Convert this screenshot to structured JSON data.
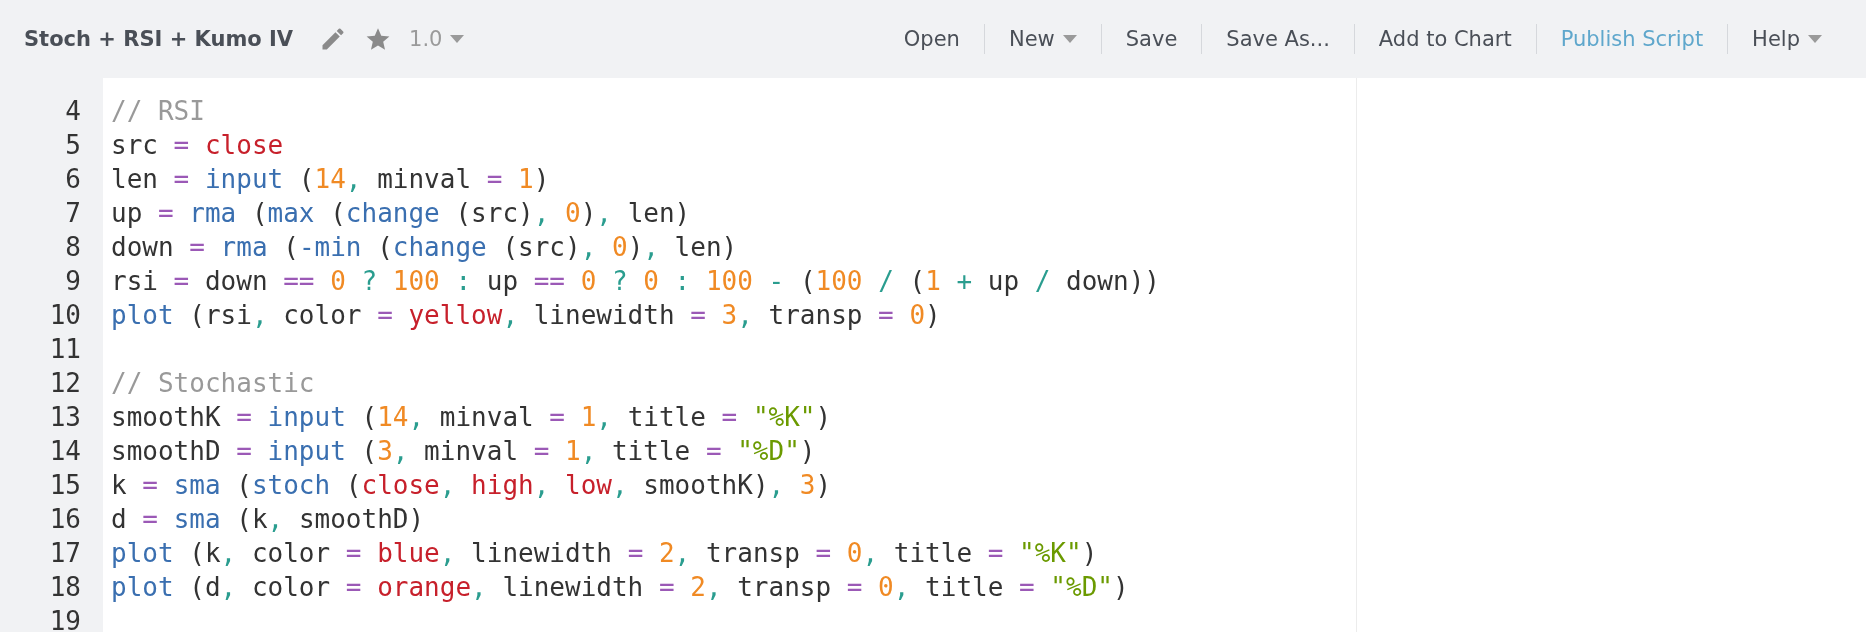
{
  "header": {
    "title": "Stoch + RSI + Kumo IV",
    "version": "1.0",
    "menu": [
      {
        "label": "Open",
        "kind": "plain"
      },
      {
        "label": "New",
        "kind": "dropdown"
      },
      {
        "label": "Save",
        "kind": "plain"
      },
      {
        "label": "Save As...",
        "kind": "plain"
      },
      {
        "label": "Add to Chart",
        "kind": "plain"
      },
      {
        "label": "Publish Script",
        "kind": "link"
      },
      {
        "label": "Help",
        "kind": "dropdown"
      }
    ]
  },
  "editor": {
    "lines": [
      {
        "number": "4",
        "tokens": [
          {
            "kind": "c",
            "text": "// RSI"
          }
        ]
      },
      {
        "number": "5",
        "tokens": [
          {
            "kind": "t",
            "text": "src"
          },
          {
            "kind": "o",
            "text": " = "
          },
          {
            "kind": "v",
            "text": "close"
          }
        ]
      },
      {
        "number": "6",
        "tokens": [
          {
            "kind": "t",
            "text": "len"
          },
          {
            "kind": "o",
            "text": " = "
          },
          {
            "kind": "f",
            "text": "input"
          },
          {
            "kind": "t",
            "text": " ("
          },
          {
            "kind": "n",
            "text": "14"
          },
          {
            "kind": "p",
            "text": ", "
          },
          {
            "kind": "t",
            "text": "minval"
          },
          {
            "kind": "o",
            "text": " = "
          },
          {
            "kind": "n",
            "text": "1"
          },
          {
            "kind": "t",
            "text": ")"
          }
        ]
      },
      {
        "number": "7",
        "tokens": [
          {
            "kind": "t",
            "text": "up"
          },
          {
            "kind": "o",
            "text": " = "
          },
          {
            "kind": "f",
            "text": "rma"
          },
          {
            "kind": "t",
            "text": " ("
          },
          {
            "kind": "f",
            "text": "max"
          },
          {
            "kind": "t",
            "text": " ("
          },
          {
            "kind": "f",
            "text": "change"
          },
          {
            "kind": "t",
            "text": " (src)"
          },
          {
            "kind": "p",
            "text": ", "
          },
          {
            "kind": "n",
            "text": "0"
          },
          {
            "kind": "t",
            "text": ")"
          },
          {
            "kind": "p",
            "text": ", "
          },
          {
            "kind": "t",
            "text": "len)"
          }
        ]
      },
      {
        "number": "8",
        "tokens": [
          {
            "kind": "t",
            "text": "down"
          },
          {
            "kind": "o",
            "text": " = "
          },
          {
            "kind": "f",
            "text": "rma"
          },
          {
            "kind": "t",
            "text": " ("
          },
          {
            "kind": "f",
            "text": "-min"
          },
          {
            "kind": "t",
            "text": " ("
          },
          {
            "kind": "f",
            "text": "change"
          },
          {
            "kind": "t",
            "text": " (src)"
          },
          {
            "kind": "p",
            "text": ", "
          },
          {
            "kind": "n",
            "text": "0"
          },
          {
            "kind": "t",
            "text": ")"
          },
          {
            "kind": "p",
            "text": ", "
          },
          {
            "kind": "t",
            "text": "len)"
          }
        ]
      },
      {
        "number": "9",
        "tokens": [
          {
            "kind": "t",
            "text": "rsi"
          },
          {
            "kind": "o",
            "text": " = "
          },
          {
            "kind": "t",
            "text": "down"
          },
          {
            "kind": "o",
            "text": " == "
          },
          {
            "kind": "n",
            "text": "0"
          },
          {
            "kind": "p",
            "text": " ? "
          },
          {
            "kind": "n",
            "text": "100"
          },
          {
            "kind": "p",
            "text": " : "
          },
          {
            "kind": "t",
            "text": "up"
          },
          {
            "kind": "o",
            "text": " == "
          },
          {
            "kind": "n",
            "text": "0"
          },
          {
            "kind": "p",
            "text": " ? "
          },
          {
            "kind": "n",
            "text": "0"
          },
          {
            "kind": "p",
            "text": " : "
          },
          {
            "kind": "n",
            "text": "100"
          },
          {
            "kind": "p",
            "text": " - "
          },
          {
            "kind": "t",
            "text": "("
          },
          {
            "kind": "n",
            "text": "100"
          },
          {
            "kind": "p",
            "text": " / "
          },
          {
            "kind": "t",
            "text": "("
          },
          {
            "kind": "n",
            "text": "1"
          },
          {
            "kind": "p",
            "text": " + "
          },
          {
            "kind": "t",
            "text": "up"
          },
          {
            "kind": "p",
            "text": " / "
          },
          {
            "kind": "t",
            "text": "down))"
          }
        ]
      },
      {
        "number": "10",
        "tokens": [
          {
            "kind": "f",
            "text": "plot"
          },
          {
            "kind": "t",
            "text": " (rsi"
          },
          {
            "kind": "p",
            "text": ", "
          },
          {
            "kind": "t",
            "text": "color"
          },
          {
            "kind": "o",
            "text": " = "
          },
          {
            "kind": "v",
            "text": "yellow"
          },
          {
            "kind": "p",
            "text": ", "
          },
          {
            "kind": "t",
            "text": "linewidth"
          },
          {
            "kind": "o",
            "text": " = "
          },
          {
            "kind": "n",
            "text": "3"
          },
          {
            "kind": "p",
            "text": ", "
          },
          {
            "kind": "t",
            "text": "transp"
          },
          {
            "kind": "o",
            "text": " = "
          },
          {
            "kind": "n",
            "text": "0"
          },
          {
            "kind": "t",
            "text": ")"
          }
        ]
      },
      {
        "number": "11"
      },
      {
        "number": "12",
        "tokens": [
          {
            "kind": "c",
            "text": "// Stochastic"
          }
        ]
      },
      {
        "number": "13",
        "tokens": [
          {
            "kind": "t",
            "text": "smoothK"
          },
          {
            "kind": "o",
            "text": " = "
          },
          {
            "kind": "f",
            "text": "input"
          },
          {
            "kind": "t",
            "text": " ("
          },
          {
            "kind": "n",
            "text": "14"
          },
          {
            "kind": "p",
            "text": ", "
          },
          {
            "kind": "t",
            "text": "minval"
          },
          {
            "kind": "o",
            "text": " = "
          },
          {
            "kind": "n",
            "text": "1"
          },
          {
            "kind": "p",
            "text": ", "
          },
          {
            "kind": "t",
            "text": "title"
          },
          {
            "kind": "o",
            "text": " = "
          },
          {
            "kind": "s",
            "text": "\"%K\""
          },
          {
            "kind": "t",
            "text": ")"
          }
        ]
      },
      {
        "number": "14",
        "tokens": [
          {
            "kind": "t",
            "text": "smoothD"
          },
          {
            "kind": "o",
            "text": " = "
          },
          {
            "kind": "f",
            "text": "input"
          },
          {
            "kind": "t",
            "text": " ("
          },
          {
            "kind": "n",
            "text": "3"
          },
          {
            "kind": "p",
            "text": ", "
          },
          {
            "kind": "t",
            "text": "minval"
          },
          {
            "kind": "o",
            "text": " = "
          },
          {
            "kind": "n",
            "text": "1"
          },
          {
            "kind": "p",
            "text": ", "
          },
          {
            "kind": "t",
            "text": "title"
          },
          {
            "kind": "o",
            "text": " = "
          },
          {
            "kind": "s",
            "text": "\"%D\""
          },
          {
            "kind": "t",
            "text": ")"
          }
        ]
      },
      {
        "number": "15",
        "tokens": [
          {
            "kind": "t",
            "text": "k"
          },
          {
            "kind": "o",
            "text": " = "
          },
          {
            "kind": "f",
            "text": "sma"
          },
          {
            "kind": "t",
            "text": " ("
          },
          {
            "kind": "f",
            "text": "stoch"
          },
          {
            "kind": "t",
            "text": " ("
          },
          {
            "kind": "v",
            "text": "close"
          },
          {
            "kind": "p",
            "text": ", "
          },
          {
            "kind": "v",
            "text": "high"
          },
          {
            "kind": "p",
            "text": ", "
          },
          {
            "kind": "v",
            "text": "low"
          },
          {
            "kind": "p",
            "text": ", "
          },
          {
            "kind": "t",
            "text": "smoothK)"
          },
          {
            "kind": "p",
            "text": ", "
          },
          {
            "kind": "n",
            "text": "3"
          },
          {
            "kind": "t",
            "text": ")"
          }
        ]
      },
      {
        "number": "16",
        "tokens": [
          {
            "kind": "t",
            "text": "d"
          },
          {
            "kind": "o",
            "text": " = "
          },
          {
            "kind": "f",
            "text": "sma"
          },
          {
            "kind": "t",
            "text": " (k"
          },
          {
            "kind": "p",
            "text": ", "
          },
          {
            "kind": "t",
            "text": "smoothD)"
          }
        ]
      },
      {
        "number": "17",
        "tokens": [
          {
            "kind": "f",
            "text": "plot"
          },
          {
            "kind": "t",
            "text": " (k"
          },
          {
            "kind": "p",
            "text": ", "
          },
          {
            "kind": "t",
            "text": "color"
          },
          {
            "kind": "o",
            "text": " = "
          },
          {
            "kind": "v",
            "text": "blue"
          },
          {
            "kind": "p",
            "text": ", "
          },
          {
            "kind": "t",
            "text": "linewidth"
          },
          {
            "kind": "o",
            "text": " = "
          },
          {
            "kind": "n",
            "text": "2"
          },
          {
            "kind": "p",
            "text": ", "
          },
          {
            "kind": "t",
            "text": "transp"
          },
          {
            "kind": "o",
            "text": " = "
          },
          {
            "kind": "n",
            "text": "0"
          },
          {
            "kind": "p",
            "text": ", "
          },
          {
            "kind": "t",
            "text": "title"
          },
          {
            "kind": "o",
            "text": " = "
          },
          {
            "kind": "s",
            "text": "\"%K\""
          },
          {
            "kind": "t",
            "text": ")"
          }
        ]
      },
      {
        "number": "18",
        "tokens": [
          {
            "kind": "f",
            "text": "plot"
          },
          {
            "kind": "t",
            "text": " (d"
          },
          {
            "kind": "p",
            "text": ", "
          },
          {
            "kind": "t",
            "text": "color"
          },
          {
            "kind": "o",
            "text": " = "
          },
          {
            "kind": "v",
            "text": "orange"
          },
          {
            "kind": "p",
            "text": ", "
          },
          {
            "kind": "t",
            "text": "linewidth"
          },
          {
            "kind": "o",
            "text": " = "
          },
          {
            "kind": "n",
            "text": "2"
          },
          {
            "kind": "p",
            "text": ", "
          },
          {
            "kind": "t",
            "text": "transp"
          },
          {
            "kind": "o",
            "text": " = "
          },
          {
            "kind": "n",
            "text": "0"
          },
          {
            "kind": "p",
            "text": ", "
          },
          {
            "kind": "t",
            "text": "title"
          },
          {
            "kind": "o",
            "text": " = "
          },
          {
            "kind": "s",
            "text": "\"%D\""
          },
          {
            "kind": "t",
            "text": ")"
          }
        ]
      },
      {
        "number": "19"
      }
    ]
  }
}
